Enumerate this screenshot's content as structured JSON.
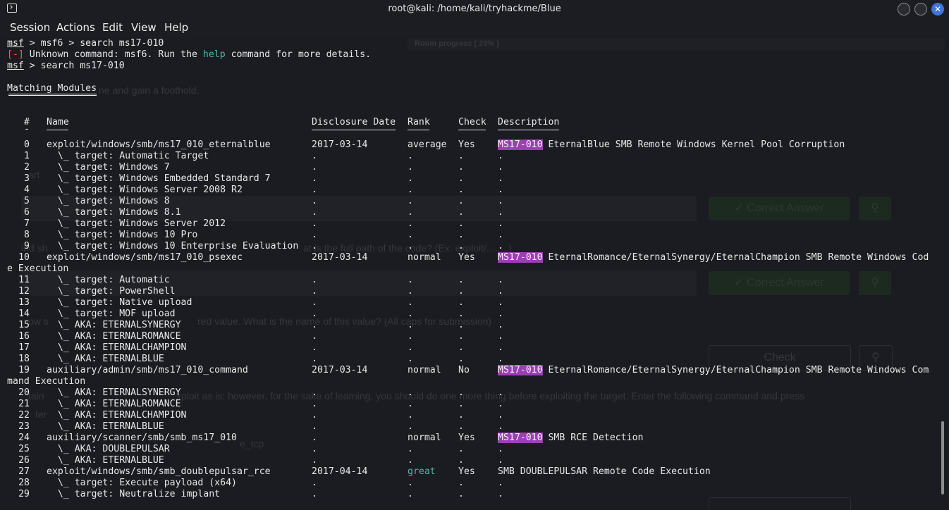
{
  "window": {
    "title": "root@kali: /home/kali/tryhackme/Blue"
  },
  "menu": [
    "Session",
    "Actions",
    "Edit",
    "View",
    "Help"
  ],
  "pre": [
    {
      "prompt": "msf",
      "text": " > msf6 > search ms17-010"
    },
    {
      "err": "[-]",
      "a": " Unknown command: msf6. Run the ",
      "cmd": "help",
      "b": " command for more details."
    },
    {
      "prompt": "msf",
      "text": " > search ms17-010"
    },
    {
      "text": ""
    },
    {
      "text": "Matching Modules"
    }
  ],
  "columns": {
    "num": "#",
    "name": "Name",
    "date": "Disclosure Date",
    "rank": "Rank",
    "check": "Check",
    "desc": "Description"
  },
  "dash": "-",
  "rows": [
    {
      "num": "0",
      "name": "exploit/windows/smb/ms17_010_eternalblue",
      "date": "2017-03-14",
      "rank": "average",
      "check": "Yes",
      "tag": "MS17-010",
      "desc": "EternalBlue SMB Remote Windows Kernel Pool Corruption"
    },
    {
      "num": "1",
      "name": "  \\_ target: Automatic Target",
      "date": ".",
      "rank": ".",
      "check": ".",
      "desc": "."
    },
    {
      "num": "2",
      "name": "  \\_ target: Windows 7",
      "date": ".",
      "rank": ".",
      "check": ".",
      "desc": "."
    },
    {
      "num": "3",
      "name": "  \\_ target: Windows Embedded Standard 7",
      "date": ".",
      "rank": ".",
      "check": ".",
      "desc": "."
    },
    {
      "num": "4",
      "name": "  \\_ target: Windows Server 2008 R2",
      "date": ".",
      "rank": ".",
      "check": ".",
      "desc": "."
    },
    {
      "num": "5",
      "name": "  \\_ target: Windows 8",
      "date": ".",
      "rank": ".",
      "check": ".",
      "desc": "."
    },
    {
      "num": "6",
      "name": "  \\_ target: Windows 8.1",
      "date": ".",
      "rank": ".",
      "check": ".",
      "desc": "."
    },
    {
      "num": "7",
      "name": "  \\_ target: Windows Server 2012",
      "date": ".",
      "rank": ".",
      "check": ".",
      "desc": "."
    },
    {
      "num": "8",
      "name": "  \\_ target: Windows 10 Pro",
      "date": ".",
      "rank": ".",
      "check": ".",
      "desc": "."
    },
    {
      "num": "9",
      "name": "  \\_ target: Windows 10 Enterprise Evaluation",
      "date": ".",
      "rank": ".",
      "check": ".",
      "desc": "."
    },
    {
      "num": "10",
      "name": "exploit/windows/smb/ms17_010_psexec",
      "date": "2017-03-14",
      "rank": "normal",
      "check": "Yes",
      "tag": "MS17-010",
      "desc": "EternalRomance/EternalSynergy/EternalChampion SMB Remote Windows Cod",
      "wrap": "e Execution"
    },
    {
      "num": "11",
      "name": "  \\_ target: Automatic",
      "date": ".",
      "rank": ".",
      "check": ".",
      "desc": "."
    },
    {
      "num": "12",
      "name": "  \\_ target: PowerShell",
      "date": ".",
      "rank": ".",
      "check": ".",
      "desc": "."
    },
    {
      "num": "13",
      "name": "  \\_ target: Native upload",
      "date": ".",
      "rank": ".",
      "check": ".",
      "desc": "."
    },
    {
      "num": "14",
      "name": "  \\_ target: MOF upload",
      "date": ".",
      "rank": ".",
      "check": ".",
      "desc": "."
    },
    {
      "num": "15",
      "name": "  \\_ AKA: ETERNALSYNERGY",
      "date": ".",
      "rank": ".",
      "check": ".",
      "desc": "."
    },
    {
      "num": "16",
      "name": "  \\_ AKA: ETERNALROMANCE",
      "date": ".",
      "rank": ".",
      "check": ".",
      "desc": "."
    },
    {
      "num": "17",
      "name": "  \\_ AKA: ETERNALCHAMPION",
      "date": ".",
      "rank": ".",
      "check": ".",
      "desc": "."
    },
    {
      "num": "18",
      "name": "  \\_ AKA: ETERNALBLUE",
      "date": ".",
      "rank": ".",
      "check": ".",
      "desc": "."
    },
    {
      "num": "19",
      "name": "auxiliary/admin/smb/ms17_010_command",
      "date": "2017-03-14",
      "rank": "normal",
      "check": "No",
      "tag": "MS17-010",
      "desc": "EternalRomance/EternalSynergy/EternalChampion SMB Remote Windows Com",
      "wrap": "mand Execution"
    },
    {
      "num": "20",
      "name": "  \\_ AKA: ETERNALSYNERGY",
      "date": ".",
      "rank": ".",
      "check": ".",
      "desc": "."
    },
    {
      "num": "21",
      "name": "  \\_ AKA: ETERNALROMANCE",
      "date": ".",
      "rank": ".",
      "check": ".",
      "desc": "."
    },
    {
      "num": "22",
      "name": "  \\_ AKA: ETERNALCHAMPION",
      "date": ".",
      "rank": ".",
      "check": ".",
      "desc": "."
    },
    {
      "num": "23",
      "name": "  \\_ AKA: ETERNALBLUE",
      "date": ".",
      "rank": ".",
      "check": ".",
      "desc": "."
    },
    {
      "num": "24",
      "name": "auxiliary/scanner/smb/smb_ms17_010",
      "date": ".",
      "rank": "normal",
      "check": "Yes",
      "tag": "MS17-010",
      "desc": "SMB RCE Detection"
    },
    {
      "num": "25",
      "name": "  \\_ AKA: DOUBLEPULSAR",
      "date": ".",
      "rank": ".",
      "check": ".",
      "desc": "."
    },
    {
      "num": "26",
      "name": "  \\_ AKA: ETERNALBLUE",
      "date": ".",
      "rank": ".",
      "check": ".",
      "desc": "."
    },
    {
      "num": "27",
      "name": "exploit/windows/smb/smb_doublepulsar_rce",
      "date": "2017-04-14",
      "rank": "great",
      "check": "Yes",
      "desc": "SMB DOUBLEPULSAR Remote Code Execution"
    },
    {
      "num": "28",
      "name": "  \\_ target: Execute payload (x64)",
      "date": ".",
      "rank": ".",
      "check": ".",
      "desc": "."
    },
    {
      "num": "29",
      "name": "  \\_ target: Neutralize implant",
      "date": ".",
      "rank": ".",
      "check": ".",
      "desc": "."
    }
  ],
  "colors": {
    "accent_highlight": "#9b3fb4",
    "cmd_teal": "#4fb7a6",
    "error_red": "#ff5555",
    "close_blue": "#3f74d9"
  },
  "background_page": {
    "room_progress": "Room progress ( 23% )",
    "line1": "ne and gain a foothold.",
    "line2": "art",
    "line3": "ind sh",
    "line3b": "at is the full path of the code? (Ex: exploit/........)",
    "line4": "ow s",
    "line4b": "red value. What is the name of this value? (All caps for submission)",
    "line5": "tain",
    "line5b": "xploit as is; however, for the sake of learning, you should do one more thing before exploiting the target. Enter the following command and press",
    "line6": "ter",
    "line7": "e_tcp",
    "btn_correct": "✓ Correct Answer",
    "btn_check": "Check",
    "hint_icon": "lightbulb-icon"
  }
}
